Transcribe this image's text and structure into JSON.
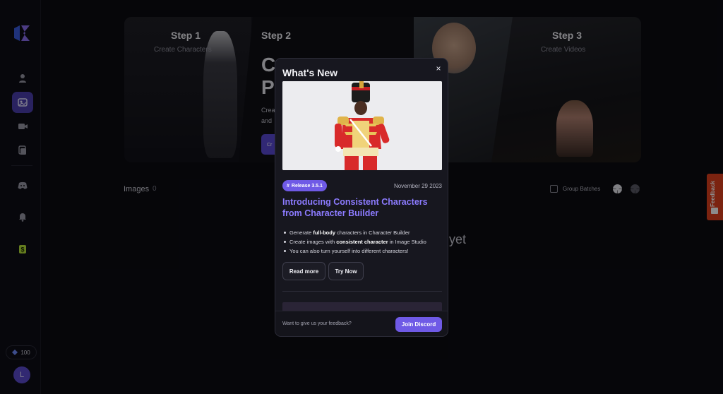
{
  "sidebar": {
    "credits": "100",
    "avatar_initial": "L"
  },
  "hero": {
    "step1_title": "Step 1",
    "step1_sub": "Create Characters",
    "step2_title": "Step 2",
    "step3_title": "Step 3",
    "step3_sub": "Create Videos",
    "headline_line1": "C",
    "headline_line2": "P",
    "desc_line1": "Crea",
    "desc_line2": "and",
    "cta_label": "Cr"
  },
  "images": {
    "label": "Images",
    "count": "0",
    "group_batches": "Group Batches",
    "empty_text": "s yet"
  },
  "feedback_tab": {
    "label": "Feedback"
  },
  "modal": {
    "title": "What's New",
    "close": "×",
    "release_badge": "Release 3.5.1",
    "release_date": "November 29 2023",
    "headline": "Introducing Consistent Characters from Character Builder",
    "bullets": [
      {
        "pre": "Generate ",
        "bold": "full-body",
        "post": " characters in Character Builder"
      },
      {
        "pre": "Create images with ",
        "bold": "consistent character",
        "post": " in Image Studio"
      },
      {
        "pre": "You can also turn yourself into different characters!",
        "bold": "",
        "post": ""
      }
    ],
    "read_more": "Read more",
    "try_now": "Try Now",
    "footer_text": "Want to give us your feedback?",
    "discord_button": "Join Discord"
  },
  "colors": {
    "accent": "#6f5ae6",
    "headline": "#8c7bff",
    "feedback": "#e0401e",
    "background": "#0b0b12"
  }
}
